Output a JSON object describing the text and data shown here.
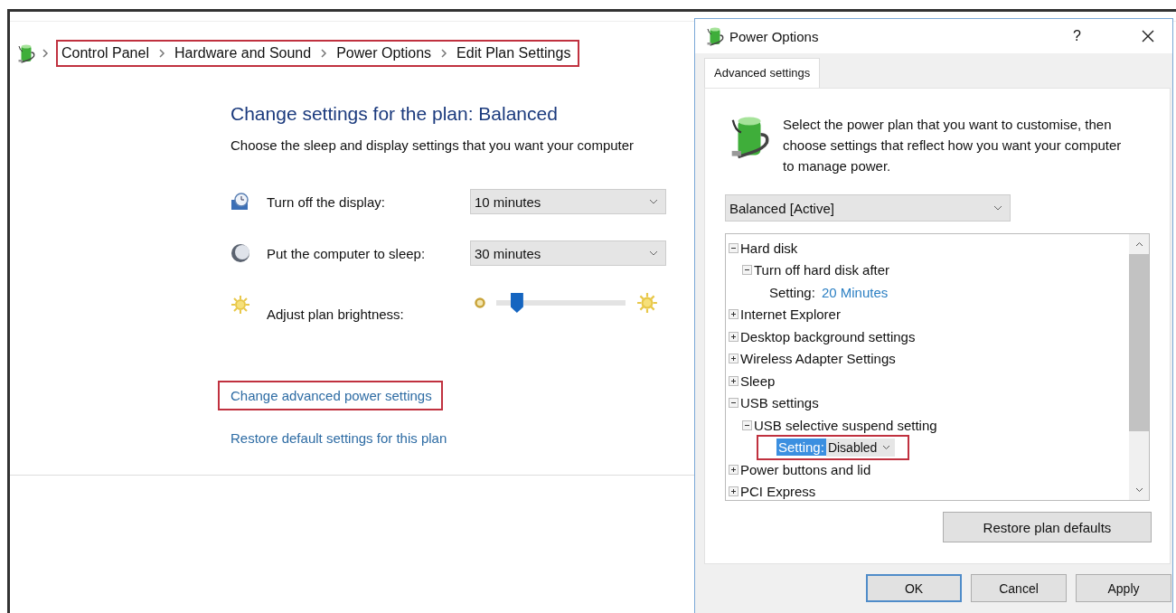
{
  "breadcrumb": {
    "annotated": true,
    "items": [
      "Control Panel",
      "Hardware and Sound",
      "Power Options",
      "Edit Plan Settings"
    ]
  },
  "plan": {
    "heading": "Change settings for the plan: Balanced",
    "description": "Choose the sleep and display settings that you want your computer",
    "settings": [
      {
        "kind": "dropdown",
        "label": "Turn off the display:",
        "value": "10 minutes"
      },
      {
        "kind": "dropdown",
        "label": "Put the computer to sleep:",
        "value": "30 minutes"
      },
      {
        "kind": "slider",
        "label": "Adjust plan brightness:",
        "level": 0.16
      }
    ],
    "links": [
      {
        "text": "Change advanced power settings",
        "annotated": true
      },
      {
        "text": "Restore default settings for this plan",
        "annotated": false
      }
    ]
  },
  "dialog": {
    "title": "Power Options",
    "help": "?",
    "tabs": [
      {
        "label": "Advanced settings",
        "selected": true
      }
    ],
    "intro": "Select the power plan that you want to customise, then choose settings that reflect how you want your computer to manage power.",
    "plan_select": "Balanced [Active]",
    "tree": [
      {
        "kind": "group",
        "label": "Hard disk",
        "expanded": true,
        "children": [
          {
            "kind": "group",
            "label": "Turn off hard disk after",
            "expanded": true,
            "children": [
              {
                "kind": "setting",
                "label": "Setting:",
                "value": "20 Minutes"
              }
            ]
          }
        ]
      },
      {
        "kind": "group",
        "label": "Internet Explorer",
        "expanded": false
      },
      {
        "kind": "group",
        "label": "Desktop background settings",
        "expanded": false
      },
      {
        "kind": "group",
        "label": "Wireless Adapter Settings",
        "expanded": false
      },
      {
        "kind": "group",
        "label": "Sleep",
        "expanded": false
      },
      {
        "kind": "group",
        "label": "USB settings",
        "expanded": true,
        "children": [
          {
            "kind": "group",
            "label": "USB selective suspend setting",
            "expanded": true,
            "children": [
              {
                "kind": "setting-dropdown",
                "label": "Setting:",
                "value": "Disabled",
                "selected": true,
                "annotated": true
              }
            ]
          }
        ]
      },
      {
        "kind": "group",
        "label": "Power buttons and lid",
        "expanded": false
      },
      {
        "kind": "group",
        "label": "PCI Express",
        "expanded": false
      }
    ],
    "restore_button": "Restore plan defaults",
    "buttons": [
      {
        "label": "OK",
        "default": true
      },
      {
        "label": "Cancel",
        "default": false
      },
      {
        "label": "Apply",
        "default": false
      }
    ]
  }
}
